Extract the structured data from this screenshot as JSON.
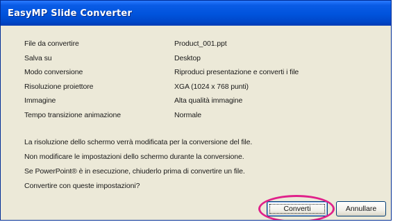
{
  "window": {
    "title": "EasyMP Slide Converter"
  },
  "fields": [
    {
      "label": "File da convertire",
      "value": "Product_001.ppt"
    },
    {
      "label": "Salva su",
      "value": "Desktop"
    },
    {
      "label": "Modo conversione",
      "value": "Riproduci presentazione e converti i file"
    },
    {
      "label": "Risoluzione proiettore",
      "value": "XGA (1024 x 768 punti)"
    },
    {
      "label": "Immagine",
      "value": "Alta qualità immagine"
    },
    {
      "label": "Tempo transizione animazione",
      "value": "Normale"
    }
  ],
  "messages": [
    "La risoluzione dello schermo verrà modificata per la conversione del file.",
    "Non modificare le impostazioni dello schermo durante la conversione.",
    "Se PowerPoint® è in esecuzione, chiuderlo prima di convertire un file.",
    "Convertire con queste impostazioni?"
  ],
  "buttons": {
    "convert": "Converti",
    "cancel": "Annullare"
  },
  "colors": {
    "titlebar": "#0053dc",
    "dialog_bg": "#ece9d8",
    "highlight_ring": "#e0218a"
  }
}
